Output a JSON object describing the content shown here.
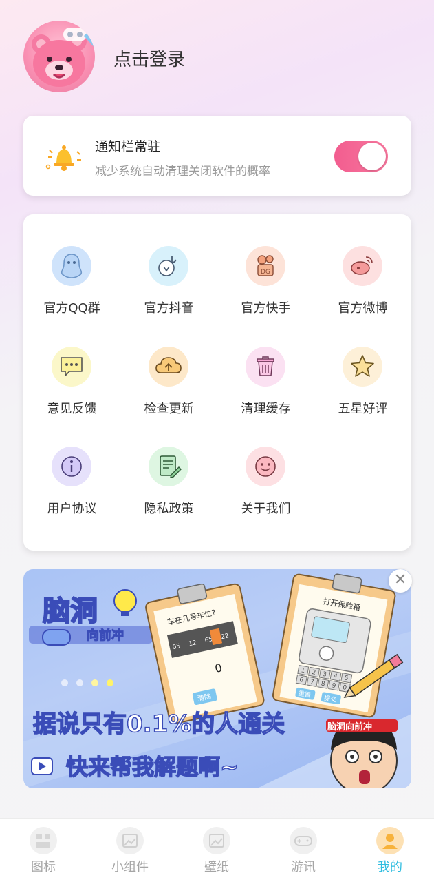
{
  "header": {
    "login_text": "点击登录"
  },
  "notify": {
    "title": "通知栏常驻",
    "desc": "减少系统自动清理关闭软件的概率",
    "enabled": true,
    "accent": "#f5689a"
  },
  "grid": [
    {
      "label": "官方QQ群",
      "icon": "qq-penguin-icon",
      "bg": "#cfe3fb"
    },
    {
      "label": "官方抖音",
      "icon": "douyin-icon",
      "bg": "#d8f1fb"
    },
    {
      "label": "官方快手",
      "icon": "kuaishou-icon",
      "bg": "#fde3d8"
    },
    {
      "label": "官方微博",
      "icon": "weibo-icon",
      "bg": "#fde0e0"
    },
    {
      "label": "意见反馈",
      "icon": "feedback-chat-icon",
      "bg": "#fbf7c9"
    },
    {
      "label": "检查更新",
      "icon": "cloud-upload-icon",
      "bg": "#fde8c9"
    },
    {
      "label": "清理缓存",
      "icon": "trash-icon",
      "bg": "#fbe1f2"
    },
    {
      "label": "五星好评",
      "icon": "star-icon",
      "bg": "#fdf0d8"
    },
    {
      "label": "用户协议",
      "icon": "info-icon",
      "bg": "#e6e1fb"
    },
    {
      "label": "隐私政策",
      "icon": "document-edit-icon",
      "bg": "#def6e2"
    },
    {
      "label": "关于我们",
      "icon": "smile-face-icon",
      "bg": "#fde0e3"
    }
  ],
  "banner": {
    "logo_title": "脑洞",
    "logo_sub": "向前冲",
    "card1_title": "车在几号车位?",
    "card1_numbers": [
      "05",
      "12",
      "65",
      "22"
    ],
    "card1_answer": "0",
    "card1_button": "清除",
    "card2_title": "打开保险箱",
    "card2_keys": [
      "1",
      "2",
      "3",
      "4",
      "5",
      "6",
      "7",
      "8",
      "9",
      "0"
    ],
    "card2_button1": "重置",
    "card2_button2": "提交",
    "headline": "据说只有0.1%的人通关",
    "subline": "快来帮我解题啊~",
    "headband_text": "脑洞向前冲"
  },
  "tabs": [
    {
      "label": "图标",
      "icon": "icons-grid-icon",
      "active": false
    },
    {
      "label": "小组件",
      "icon": "widget-icon",
      "active": false
    },
    {
      "label": "壁纸",
      "icon": "wallpaper-icon",
      "active": false
    },
    {
      "label": "游讯",
      "icon": "gamepad-icon",
      "active": false
    },
    {
      "label": "我的",
      "icon": "profile-icon",
      "active": true
    }
  ]
}
